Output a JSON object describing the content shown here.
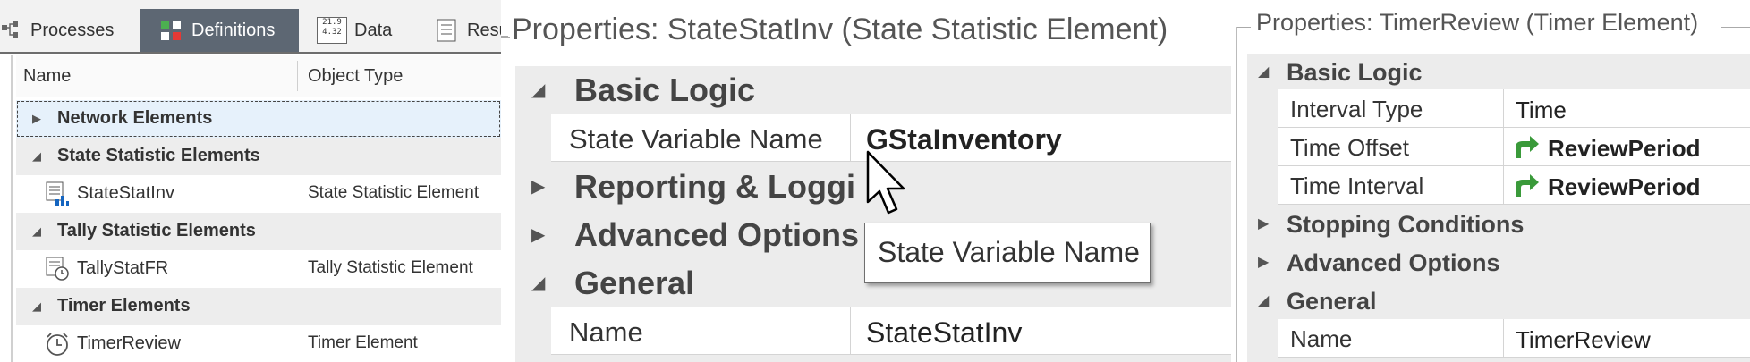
{
  "left_panel": {
    "tabs": [
      {
        "label": "Processes",
        "icon": "processes-icon"
      },
      {
        "label": "Definitions",
        "icon": "definitions-icon",
        "active": true
      },
      {
        "label": "Data",
        "icon": "data-table-icon"
      },
      {
        "label": "Resu",
        "icon": "results-icon"
      }
    ],
    "data_icon_text": [
      "21.9",
      "4.32"
    ],
    "columns": {
      "name": "Name",
      "type": "Object Type"
    },
    "groups": [
      {
        "label": "Network Elements"
      },
      {
        "label": "State Statistic Elements"
      },
      {
        "label": "Tally Statistic Elements"
      },
      {
        "label": "Timer Elements"
      }
    ],
    "items": [
      {
        "name": "StateStatInv",
        "type": "State Statistic Element"
      },
      {
        "name": "TallyStatFR",
        "type": "Tally Statistic Element"
      },
      {
        "name": "TimerReview",
        "type": "Timer Element"
      }
    ]
  },
  "middle_panel": {
    "title": "Properties: StateStatInv (State Statistic Element)",
    "categories": [
      "Basic Logic",
      "Reporting & Logging",
      "Advanced Options",
      "General"
    ],
    "reporting_visible": "Reporting & Loggi",
    "properties": [
      {
        "key": "State Variable Name",
        "value": "GStaInventory"
      },
      {
        "key": "Name",
        "value": "StateStatInv"
      }
    ],
    "tooltip": "State Variable Name"
  },
  "right_panel": {
    "title": "Properties: TimerReview (Timer Element)",
    "categories": [
      "Basic Logic",
      "Stopping Conditions",
      "Advanced Options",
      "General"
    ],
    "properties": [
      {
        "key": "Interval Type",
        "value": "Time"
      },
      {
        "key": "Time Offset",
        "value": "ReviewPeriod"
      },
      {
        "key": "Time Interval",
        "value": "ReviewPeriod"
      },
      {
        "key": "Name",
        "value": "TimerReview"
      }
    ]
  },
  "colors": {
    "active_tab": "#5d6773",
    "reference_arrow": "#3a9a3a",
    "selected_row": "#e6f1fb"
  }
}
